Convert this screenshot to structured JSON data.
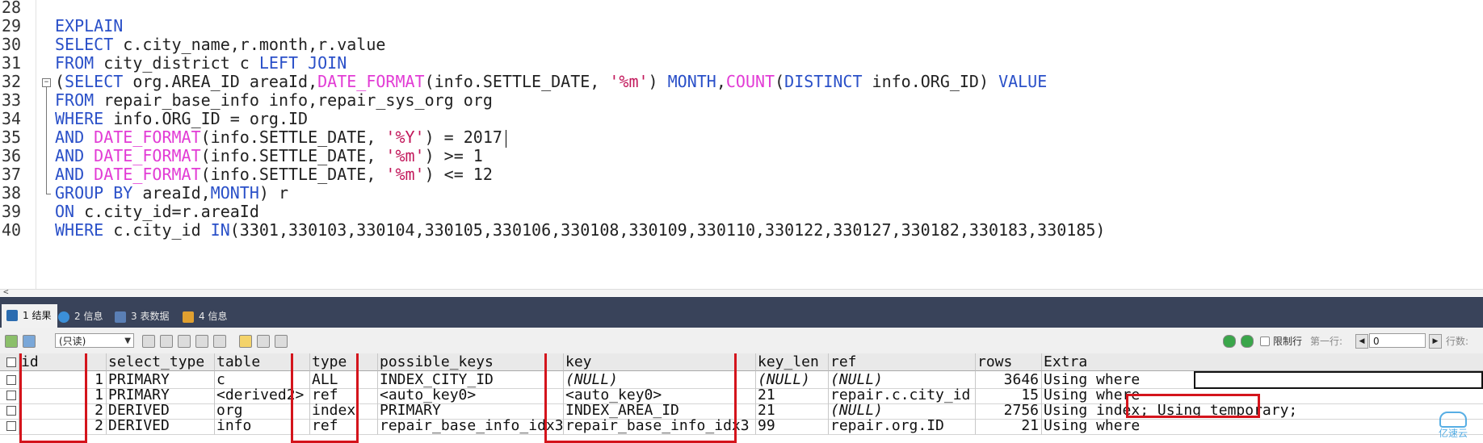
{
  "editor": {
    "line_numbers": [
      "28",
      "29",
      "30",
      "31",
      "32",
      "33",
      "34",
      "35",
      "36",
      "37",
      "38",
      "39",
      "40"
    ],
    "lines": [
      [],
      [
        {
          "t": "EXPLAIN",
          "c": "kw"
        }
      ],
      [
        {
          "t": "SELECT",
          "c": "kw"
        },
        {
          "t": " c.city_name,r.month,r.value",
          "c": ""
        }
      ],
      [
        {
          "t": "FROM",
          "c": "kw"
        },
        {
          "t": " city_district c ",
          "c": ""
        },
        {
          "t": "LEFT JOIN",
          "c": "kw"
        }
      ],
      [
        {
          "t": "(",
          "c": ""
        },
        {
          "t": "SELECT",
          "c": "kw"
        },
        {
          "t": " org.AREA_ID areaId,",
          "c": ""
        },
        {
          "t": "DATE_FORMAT",
          "c": "fn"
        },
        {
          "t": "(info.SETTLE_DATE, ",
          "c": ""
        },
        {
          "t": "'%m'",
          "c": "str"
        },
        {
          "t": ") ",
          "c": ""
        },
        {
          "t": "MONTH",
          "c": "kw"
        },
        {
          "t": ",",
          "c": ""
        },
        {
          "t": "COUNT",
          "c": "fn"
        },
        {
          "t": "(",
          "c": ""
        },
        {
          "t": "DISTINCT",
          "c": "kw"
        },
        {
          "t": " info.ORG_ID) ",
          "c": ""
        },
        {
          "t": "VALUE",
          "c": "kw"
        }
      ],
      [
        {
          "t": "FROM",
          "c": "kw"
        },
        {
          "t": " repair_base_info info,repair_sys_org org",
          "c": ""
        }
      ],
      [
        {
          "t": "WHERE",
          "c": "kw"
        },
        {
          "t": " info.ORG_ID = org.ID",
          "c": ""
        }
      ],
      [
        {
          "t": "AND",
          "c": "kw"
        },
        {
          "t": " ",
          "c": ""
        },
        {
          "t": "DATE_FORMAT",
          "c": "fn"
        },
        {
          "t": "(info.SETTLE_DATE, ",
          "c": ""
        },
        {
          "t": "'%Y'",
          "c": "str"
        },
        {
          "t": ") = 2017",
          "c": ""
        },
        {
          "t": "",
          "c": "caret"
        }
      ],
      [
        {
          "t": "AND",
          "c": "kw"
        },
        {
          "t": " ",
          "c": ""
        },
        {
          "t": "DATE_FORMAT",
          "c": "fn"
        },
        {
          "t": "(info.SETTLE_DATE, ",
          "c": ""
        },
        {
          "t": "'%m'",
          "c": "str"
        },
        {
          "t": ") >= 1",
          "c": ""
        }
      ],
      [
        {
          "t": "AND",
          "c": "kw"
        },
        {
          "t": " ",
          "c": ""
        },
        {
          "t": "DATE_FORMAT",
          "c": "fn"
        },
        {
          "t": "(info.SETTLE_DATE, ",
          "c": ""
        },
        {
          "t": "'%m'",
          "c": "str"
        },
        {
          "t": ") <= 12",
          "c": ""
        }
      ],
      [
        {
          "t": "GROUP BY",
          "c": "kw"
        },
        {
          "t": " areaId,",
          "c": ""
        },
        {
          "t": "MONTH",
          "c": "kw"
        },
        {
          "t": ") r",
          "c": ""
        }
      ],
      [
        {
          "t": "ON",
          "c": "kw"
        },
        {
          "t": " c.city_id=r.areaId",
          "c": ""
        }
      ],
      [
        {
          "t": "WHERE",
          "c": "kw"
        },
        {
          "t": " c.city_id ",
          "c": ""
        },
        {
          "t": "IN",
          "c": "kw"
        },
        {
          "t": "(3301,330103,330104,330105,330106,330108,330109,330110,330122,330127,330182,330183,330185)",
          "c": ""
        }
      ]
    ],
    "fold_icon": "collapse-minus-icon",
    "scroll_arrow": "<"
  },
  "tabs": [
    {
      "label": "1 结果",
      "icon": "result-grid-icon",
      "active": true,
      "color": "#2b6cb0"
    },
    {
      "label": "2 信息",
      "icon": "info-icon",
      "active": false,
      "color": "#3b8fd8"
    },
    {
      "label": "3 表数据",
      "icon": "table-data-icon",
      "active": false,
      "color": "#5a7fb5"
    },
    {
      "label": "4 信息",
      "icon": "info-icon",
      "active": false,
      "color": "#e0a030"
    }
  ],
  "toolbar": {
    "readonly_value": "(只读)",
    "limit_label": "限制行",
    "first_row_label": "第一行:",
    "first_row_value": "0",
    "rows_label": "行数:",
    "icons": [
      "export-icon",
      "import-icon",
      "copy-icon",
      "paste-icon",
      "save-icon",
      "delete-icon",
      "refresh-icon",
      "grid-view-icon",
      "form-view-icon",
      "text-view-icon",
      "filter-icon",
      "reload-icon"
    ]
  },
  "grid": {
    "columns": [
      "id",
      "select_type",
      "table",
      "type",
      "possible_keys",
      "key",
      "key_len",
      "ref",
      "rows",
      "Extra"
    ],
    "rows": [
      [
        "1",
        "PRIMARY",
        "c",
        "ALL",
        "INDEX_CITY_ID",
        "(NULL)",
        "(NULL)",
        "(NULL)",
        "3646",
        "Using where"
      ],
      [
        "1",
        "PRIMARY",
        "<derived2>",
        "ref",
        "<auto_key0>",
        "<auto_key0>",
        "21",
        "repair.c.city_id",
        "15",
        "Using where"
      ],
      [
        "2",
        "DERIVED",
        "org",
        "index",
        "PRIMARY",
        "INDEX_AREA_ID",
        "21",
        "(NULL)",
        "2756",
        "Using index; Using temporary;"
      ],
      [
        "2",
        "DERIVED",
        "info",
        "ref",
        "repair_base_info_idx3",
        "repair_base_info_idx3",
        "99",
        "repair.org.ID",
        "21",
        "Using where"
      ]
    ],
    "italic_null": "(NULL)",
    "highlight_color": "#d4141c"
  },
  "watermark": "亿速云"
}
